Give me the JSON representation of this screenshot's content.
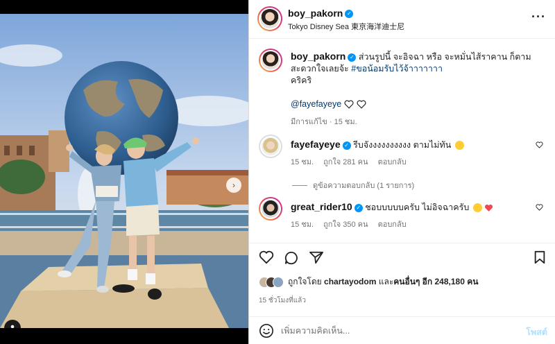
{
  "post": {
    "author": "boy_pakorn",
    "location": "Tokyo Disney Sea 東京海洋迪士尼",
    "more_icon": "more-horizontal-icon"
  },
  "caption": {
    "author": "boy_pakorn",
    "text": "ส่วนรูปนี้ จะอิจฉา หรือ จะหมั่นไส้ราคาน ก็ตามสะดวกใจเลยจ้ะ ",
    "hashtag": "#ขอน้อมรับไว้จ้าาาาาาา",
    "line2": "คริคริ",
    "mention": "@fayefayeye",
    "edited_label": "มีการแก้ไข · 15 ชม."
  },
  "comments": [
    {
      "author": "fayefayeye",
      "text": "รีบจังงงงงงงงงง ตามไม่ทัน",
      "emoji": "rolling-laugh-emoji",
      "time": "15 ชม.",
      "likes": "ถูกใจ 281 คน",
      "reply": "ตอบกลับ"
    },
    {
      "author": "great_rider10",
      "text": "ชอบบบบบครับ ไม่อิจฉาครับ",
      "emoji": "grin-sweat-emoji",
      "time": "15 ชม.",
      "likes": "ถูกใจ 350 คน",
      "reply": "ตอบกลับ"
    }
  ],
  "view_replies": "ดูข้อความตอบกลับ (1 รายการ)",
  "likes_summary": {
    "prefix": "ถูกใจโดย ",
    "user": "chartayodom",
    "middle": " และ",
    "others": "คนอื่นๆ อีก 248,180 คน"
  },
  "timestamp": "15 ชั่วโมงที่แล้ว",
  "comment_box": {
    "placeholder": "เพิ่มความคิดเห็น...",
    "post_label": "โพสต์"
  },
  "carousel": {
    "total": 7,
    "current": 1
  },
  "colors": {
    "verified": "#0095f6",
    "link": "#00376b",
    "accent": "#3897f0",
    "red_heart": "#ed4956"
  }
}
